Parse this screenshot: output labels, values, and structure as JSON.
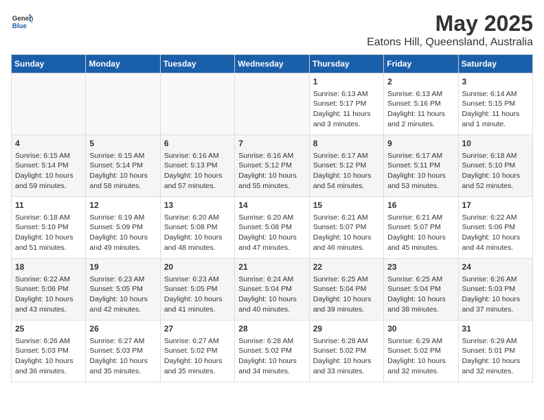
{
  "header": {
    "logo_line1": "General",
    "logo_line2": "Blue",
    "title": "May 2025",
    "subtitle": "Eatons Hill, Queensland, Australia"
  },
  "days_of_week": [
    "Sunday",
    "Monday",
    "Tuesday",
    "Wednesday",
    "Thursday",
    "Friday",
    "Saturday"
  ],
  "weeks": [
    [
      {
        "day": "",
        "content": ""
      },
      {
        "day": "",
        "content": ""
      },
      {
        "day": "",
        "content": ""
      },
      {
        "day": "",
        "content": ""
      },
      {
        "day": "1",
        "content": "Sunrise: 6:13 AM\nSunset: 5:17 PM\nDaylight: 11 hours\nand 3 minutes."
      },
      {
        "day": "2",
        "content": "Sunrise: 6:13 AM\nSunset: 5:16 PM\nDaylight: 11 hours\nand 2 minutes."
      },
      {
        "day": "3",
        "content": "Sunrise: 6:14 AM\nSunset: 5:15 PM\nDaylight: 11 hours\nand 1 minute."
      }
    ],
    [
      {
        "day": "4",
        "content": "Sunrise: 6:15 AM\nSunset: 5:14 PM\nDaylight: 10 hours\nand 59 minutes."
      },
      {
        "day": "5",
        "content": "Sunrise: 6:15 AM\nSunset: 5:14 PM\nDaylight: 10 hours\nand 58 minutes."
      },
      {
        "day": "6",
        "content": "Sunrise: 6:16 AM\nSunset: 5:13 PM\nDaylight: 10 hours\nand 57 minutes."
      },
      {
        "day": "7",
        "content": "Sunrise: 6:16 AM\nSunset: 5:12 PM\nDaylight: 10 hours\nand 55 minutes."
      },
      {
        "day": "8",
        "content": "Sunrise: 6:17 AM\nSunset: 5:12 PM\nDaylight: 10 hours\nand 54 minutes."
      },
      {
        "day": "9",
        "content": "Sunrise: 6:17 AM\nSunset: 5:11 PM\nDaylight: 10 hours\nand 53 minutes."
      },
      {
        "day": "10",
        "content": "Sunrise: 6:18 AM\nSunset: 5:10 PM\nDaylight: 10 hours\nand 52 minutes."
      }
    ],
    [
      {
        "day": "11",
        "content": "Sunrise: 6:18 AM\nSunset: 5:10 PM\nDaylight: 10 hours\nand 51 minutes."
      },
      {
        "day": "12",
        "content": "Sunrise: 6:19 AM\nSunset: 5:09 PM\nDaylight: 10 hours\nand 49 minutes."
      },
      {
        "day": "13",
        "content": "Sunrise: 6:20 AM\nSunset: 5:08 PM\nDaylight: 10 hours\nand 48 minutes."
      },
      {
        "day": "14",
        "content": "Sunrise: 6:20 AM\nSunset: 5:08 PM\nDaylight: 10 hours\nand 47 minutes."
      },
      {
        "day": "15",
        "content": "Sunrise: 6:21 AM\nSunset: 5:07 PM\nDaylight: 10 hours\nand 46 minutes."
      },
      {
        "day": "16",
        "content": "Sunrise: 6:21 AM\nSunset: 5:07 PM\nDaylight: 10 hours\nand 45 minutes."
      },
      {
        "day": "17",
        "content": "Sunrise: 6:22 AM\nSunset: 5:06 PM\nDaylight: 10 hours\nand 44 minutes."
      }
    ],
    [
      {
        "day": "18",
        "content": "Sunrise: 6:22 AM\nSunset: 5:06 PM\nDaylight: 10 hours\nand 43 minutes."
      },
      {
        "day": "19",
        "content": "Sunrise: 6:23 AM\nSunset: 5:05 PM\nDaylight: 10 hours\nand 42 minutes."
      },
      {
        "day": "20",
        "content": "Sunrise: 6:23 AM\nSunset: 5:05 PM\nDaylight: 10 hours\nand 41 minutes."
      },
      {
        "day": "21",
        "content": "Sunrise: 6:24 AM\nSunset: 5:04 PM\nDaylight: 10 hours\nand 40 minutes."
      },
      {
        "day": "22",
        "content": "Sunrise: 6:25 AM\nSunset: 5:04 PM\nDaylight: 10 hours\nand 39 minutes."
      },
      {
        "day": "23",
        "content": "Sunrise: 6:25 AM\nSunset: 5:04 PM\nDaylight: 10 hours\nand 38 minutes."
      },
      {
        "day": "24",
        "content": "Sunrise: 6:26 AM\nSunset: 5:03 PM\nDaylight: 10 hours\nand 37 minutes."
      }
    ],
    [
      {
        "day": "25",
        "content": "Sunrise: 6:26 AM\nSunset: 5:03 PM\nDaylight: 10 hours\nand 36 minutes."
      },
      {
        "day": "26",
        "content": "Sunrise: 6:27 AM\nSunset: 5:03 PM\nDaylight: 10 hours\nand 35 minutes."
      },
      {
        "day": "27",
        "content": "Sunrise: 6:27 AM\nSunset: 5:02 PM\nDaylight: 10 hours\nand 35 minutes."
      },
      {
        "day": "28",
        "content": "Sunrise: 6:28 AM\nSunset: 5:02 PM\nDaylight: 10 hours\nand 34 minutes."
      },
      {
        "day": "29",
        "content": "Sunrise: 6:28 AM\nSunset: 5:02 PM\nDaylight: 10 hours\nand 33 minutes."
      },
      {
        "day": "30",
        "content": "Sunrise: 6:29 AM\nSunset: 5:02 PM\nDaylight: 10 hours\nand 32 minutes."
      },
      {
        "day": "31",
        "content": "Sunrise: 6:29 AM\nSunset: 5:01 PM\nDaylight: 10 hours\nand 32 minutes."
      }
    ]
  ]
}
